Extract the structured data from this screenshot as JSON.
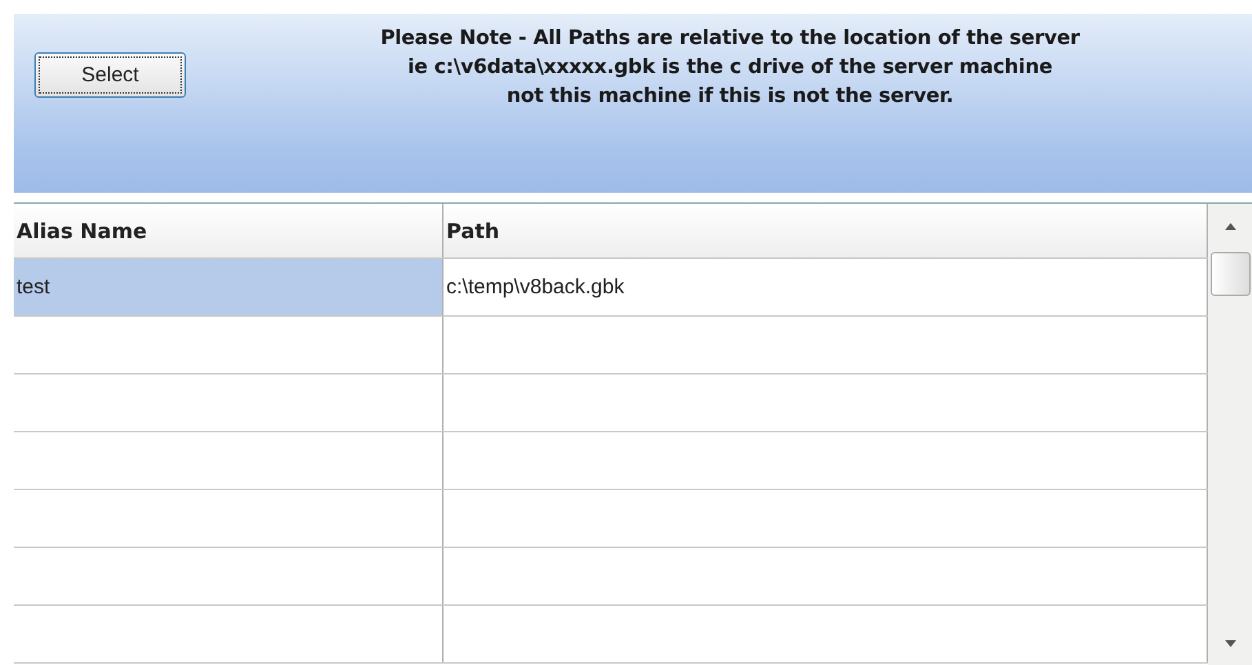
{
  "toolbar": {
    "select_button": "Select",
    "note_lines": [
      "Please Note - All Paths are relative to the location of the server",
      "ie c:\\v6data\\xxxxx.gbk is the c drive of the server machine",
      "not this machine if this is not the server."
    ]
  },
  "table": {
    "columns": [
      "Alias Name",
      "Path"
    ],
    "rows": [
      {
        "alias": "test",
        "path": "c:\\temp\\v8back.gbk",
        "selected": true
      }
    ]
  }
}
